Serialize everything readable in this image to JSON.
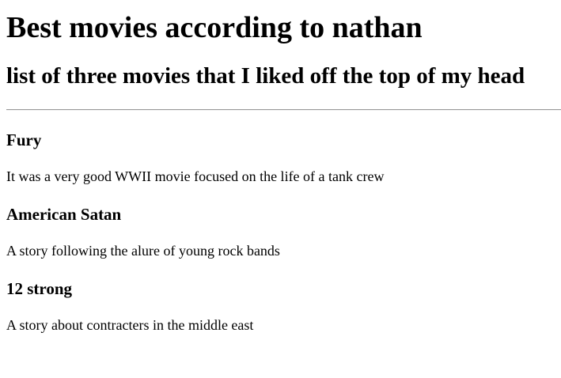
{
  "page": {
    "title": "Best movies according to nathan",
    "subtitle": "list of three movies that I liked off the top of my head"
  },
  "movies": [
    {
      "title": "Fury",
      "description": "It was a very good WWII movie focused on the life of a tank crew"
    },
    {
      "title": "American Satan",
      "description": "A story following the alure of young rock bands"
    },
    {
      "title": "12 strong",
      "description": "A story about contracters in the middle east"
    }
  ]
}
